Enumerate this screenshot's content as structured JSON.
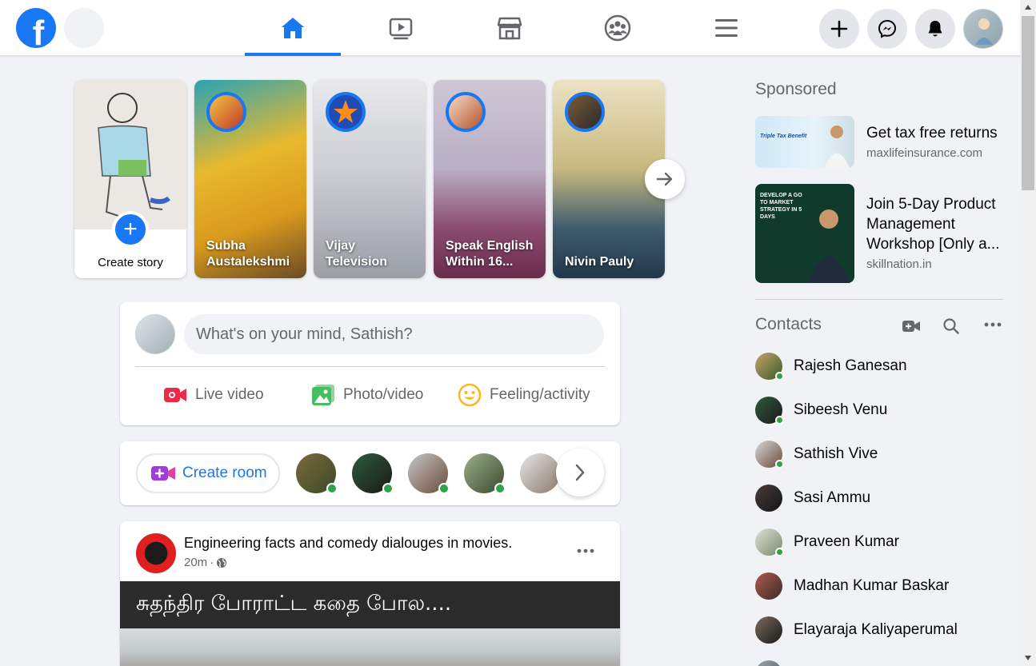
{
  "colors": {
    "accent": "#1877f2",
    "online": "#31a24c",
    "page_bg": "#f0f2f5",
    "secondary_text": "#65676b"
  },
  "header": {
    "logo_letter": "f",
    "nav_tabs": [
      {
        "id": "home",
        "icon": "home-icon",
        "active": true
      },
      {
        "id": "watch",
        "icon": "video-play-icon",
        "active": false
      },
      {
        "id": "marketplace",
        "icon": "store-icon",
        "active": false
      },
      {
        "id": "groups",
        "icon": "groups-icon",
        "active": false
      },
      {
        "id": "menu",
        "icon": "hamburger-menu-icon",
        "active": false
      }
    ],
    "right_icons": [
      "plus-icon",
      "messenger-icon",
      "bell-icon",
      "profile-avatar"
    ]
  },
  "stories": {
    "create_label": "Create story",
    "items": [
      {
        "name": "Subha Austalekshmi"
      },
      {
        "name": "Vijay Television"
      },
      {
        "name": "Speak English Within 16..."
      },
      {
        "name": "Nivin Pauly"
      }
    ]
  },
  "composer": {
    "placeholder": "What's on your mind, Sathish?",
    "actions": [
      {
        "label": "Live video",
        "icon": "live-video-icon"
      },
      {
        "label": "Photo/video",
        "icon": "photo-icon"
      },
      {
        "label": "Feeling/activity",
        "icon": "smiley-icon"
      }
    ]
  },
  "rooms": {
    "create_label": "Create room",
    "icon": "video-room-icon"
  },
  "post": {
    "page_name": "Engineering facts and comedy dialouges in movies.",
    "time": "20m",
    "separator": "·",
    "privacy_icon": "globe-icon",
    "banner_text": "சுதந்திர போராட்ட கதை போல...."
  },
  "sponsored": {
    "title": "Sponsored",
    "ads": [
      {
        "headline": "Get tax free returns",
        "domain": "maxlifeinsurance.com",
        "img_text": "Triple Tax Benefit"
      },
      {
        "headline": "Join 5-Day Product Management Workshop [Only a...",
        "domain": "skillnation.in",
        "img_text": "DEVELOP A GO TO MARKET STRATEGY IN 5 DAYS"
      }
    ]
  },
  "contacts": {
    "title": "Contacts",
    "tool_icons": [
      "video-add-icon",
      "search-icon",
      "more-dots-icon"
    ],
    "items": [
      {
        "name": "Rajesh Ganesan",
        "online": true
      },
      {
        "name": "Sibeesh Venu",
        "online": true
      },
      {
        "name": "Sathish Vive",
        "online": true
      },
      {
        "name": "Sasi Ammu",
        "online": false
      },
      {
        "name": "Praveen Kumar",
        "online": true
      },
      {
        "name": "Madhan Kumar Baskar",
        "online": false
      },
      {
        "name": "Elayaraja Kaliyaperumal",
        "online": false
      }
    ]
  }
}
